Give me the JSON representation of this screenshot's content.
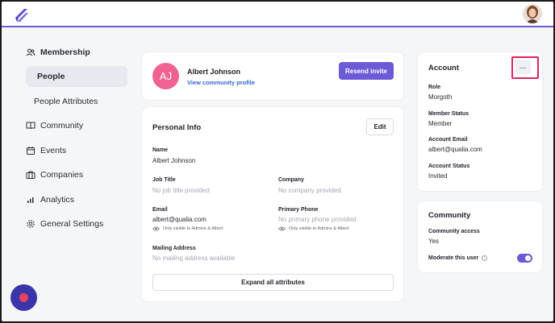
{
  "sidebar": {
    "section_label": "Membership",
    "items": [
      {
        "label": "People",
        "icon": "user-icon"
      },
      {
        "label": "People Attributes"
      },
      {
        "label": "Community",
        "icon": "book-icon"
      },
      {
        "label": "Events",
        "icon": "calendar-icon"
      },
      {
        "label": "Companies",
        "icon": "briefcase-icon"
      },
      {
        "label": "Analytics",
        "icon": "bar-chart-icon"
      },
      {
        "label": "General Settings",
        "icon": "gear-icon"
      }
    ]
  },
  "profile": {
    "initials": "AJ",
    "name": "Albert Johnson",
    "link": "View community profile",
    "resend_label": "Resend invite"
  },
  "personal_info": {
    "title": "Personal Info",
    "edit_label": "Edit",
    "name_label": "Name",
    "name_value": "Albert Johnson",
    "job_label": "Job Title",
    "job_value": "No job title provided",
    "company_label": "Company",
    "company_value": "No company provided",
    "email_label": "Email",
    "email_value": "albert@qualia.com",
    "email_note": "Only visible to Admins & Albert",
    "phone_label": "Primary Phone",
    "phone_value": "No primary phone provided",
    "phone_note": "Only visible to Admins & Albert",
    "mailing_label": "Mailing Address",
    "mailing_value": "No mailing address available",
    "expand_label": "Expand all attributes"
  },
  "account": {
    "title": "Account",
    "more_label": "...",
    "role_label": "Role",
    "role_value": "Morgoth",
    "status_label": "Member Status",
    "status_value": "Member",
    "email_label": "Account Email",
    "email_value": "albert@qualia.com",
    "acct_status_label": "Account Status",
    "acct_status_value": "Invited"
  },
  "community": {
    "title": "Community",
    "access_label": "Community access",
    "access_value": "Yes",
    "moderate_label": "Moderate this user",
    "moderate_on": true
  },
  "colors": {
    "accent": "#6b5bd6",
    "avatar": "#f06292",
    "highlight": "#e0245e"
  }
}
